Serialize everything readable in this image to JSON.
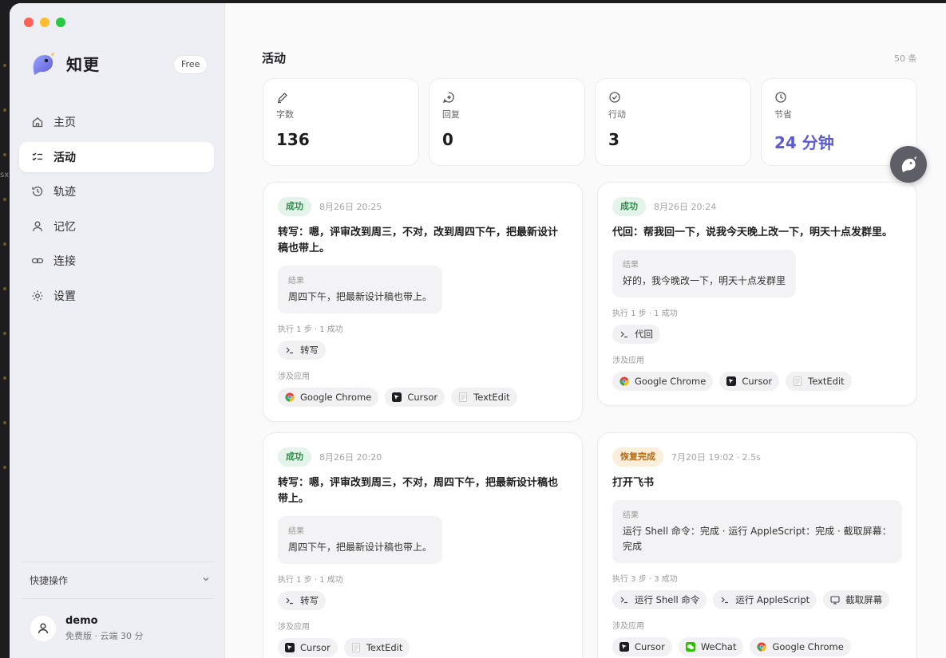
{
  "app": {
    "name": "知更",
    "plan_badge": "Free"
  },
  "sidebar": {
    "items": [
      {
        "label": "主页",
        "icon": "home-icon"
      },
      {
        "label": "活动",
        "icon": "checklist-icon"
      },
      {
        "label": "轨迹",
        "icon": "history-icon"
      },
      {
        "label": "记忆",
        "icon": "person-icon"
      },
      {
        "label": "连接",
        "icon": "link-icon"
      },
      {
        "label": "设置",
        "icon": "gear-icon"
      }
    ],
    "quick_actions": "快捷操作",
    "user": {
      "name": "demo",
      "plan": "免费版 · 云端 30 分"
    }
  },
  "main": {
    "title": "活动",
    "count": "50 条",
    "stats": [
      {
        "label": "字数",
        "value": "136",
        "icon": "pen-icon"
      },
      {
        "label": "回复",
        "value": "0",
        "icon": "reply-icon"
      },
      {
        "label": "行动",
        "value": "3",
        "icon": "check-circle-icon"
      },
      {
        "label": "节省",
        "value": "24 分钟",
        "icon": "clock-icon"
      }
    ],
    "cards": [
      {
        "status": "成功",
        "time": "8月26日 20:25",
        "title": "转写：嗯，评审改到周三，不对，改到周四下午，把最新设计稿也带上。",
        "result_label": "结果",
        "result": "周四下午，把最新设计稿也带上。",
        "steps": "执行 1 步 · 1 成功",
        "actions": [
          "转写"
        ],
        "apps_label": "涉及应用",
        "apps": [
          "Google Chrome",
          "Cursor",
          "TextEdit"
        ]
      },
      {
        "status": "成功",
        "time": "8月26日 20:24",
        "title": "代回：帮我回一下，说我今天晚上改一下，明天十点发群里。",
        "result_label": "结果",
        "result": "好的，我今晚改一下，明天十点发群里",
        "steps": "执行 1 步 · 1 成功",
        "actions": [
          "代回"
        ],
        "apps_label": "涉及应用",
        "apps": [
          "Google Chrome",
          "Cursor",
          "TextEdit"
        ]
      },
      {
        "status": "成功",
        "time": "8月26日 20:20",
        "title": "转写：嗯，评审改到周三，不对，周四下午，把最新设计稿也带上。",
        "result_label": "结果",
        "result": "周四下午，把最新设计稿也带上。",
        "steps": "执行 1 步 · 1 成功",
        "actions": [
          "转写"
        ],
        "apps_label": "涉及应用",
        "apps": [
          "Cursor",
          "TextEdit"
        ]
      },
      {
        "status": "恢复完成",
        "time": "7月20日 19:02 · 2.5s",
        "title": "打开飞书",
        "result_label": "结果",
        "result": "运行 Shell 命令：完成 · 运行 AppleScript：完成 · 截取屏幕：完成",
        "steps": "执行 3 步 · 3 成功",
        "actions": [
          "运行 Shell 命令",
          "运行 AppleScript",
          "截取屏幕"
        ],
        "apps_label": "涉及应用",
        "apps": [
          "Cursor",
          "WeChat",
          "Google Chrome"
        ]
      }
    ]
  },
  "colors": {
    "accent": "#5b5bd6",
    "success": "#2f8a4c",
    "warn": "#b26a19"
  }
}
